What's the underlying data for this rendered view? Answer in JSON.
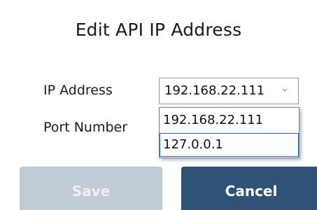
{
  "dialog": {
    "title": "Edit API IP Address"
  },
  "fields": {
    "ip_label": "IP Address",
    "port_label": "Port Number"
  },
  "ip_select": {
    "selected_value": "192.168.22.111",
    "options": [
      "192.168.22.111",
      "127.0.0.1"
    ],
    "highlighted_option": "127.0.0.1"
  },
  "buttons": {
    "save_label": "Save",
    "cancel_label": "Cancel",
    "save_enabled": false
  },
  "colors": {
    "save_disabled_bg": "#c2ccd4",
    "cancel_bg": "#2f5377",
    "focus_border": "#2a64b6"
  },
  "icons": {
    "dropdown": "chevron-down-icon"
  }
}
